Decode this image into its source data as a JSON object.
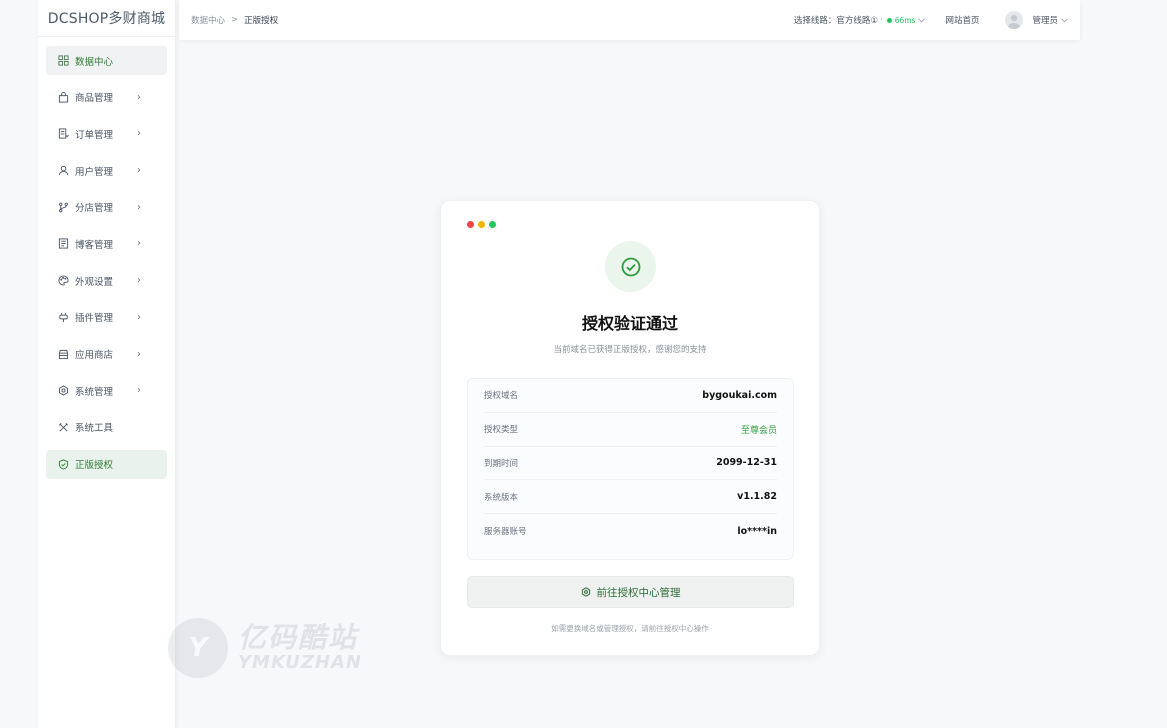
{
  "sidebar": {
    "logo": "DCSHOP多财商城",
    "items": [
      {
        "label": "数据中心",
        "icon": "dashboard-icon",
        "arrow": false
      },
      {
        "label": "商品管理",
        "icon": "shopping-bag-icon",
        "arrow": true
      },
      {
        "label": "订单管理",
        "icon": "order-list-icon",
        "arrow": true
      },
      {
        "label": "用户管理",
        "icon": "user-icon",
        "arrow": true
      },
      {
        "label": "分店管理",
        "icon": "branch-icon",
        "arrow": true
      },
      {
        "label": "博客管理",
        "icon": "document-icon",
        "arrow": true
      },
      {
        "label": "外观设置",
        "icon": "palette-icon",
        "arrow": true
      },
      {
        "label": "插件管理",
        "icon": "plugin-icon",
        "arrow": true
      },
      {
        "label": "应用商店",
        "icon": "store-icon",
        "arrow": true
      },
      {
        "label": "系统管理",
        "icon": "gear-icon",
        "arrow": true
      },
      {
        "label": "系统工具",
        "icon": "tools-icon",
        "arrow": false
      },
      {
        "label": "正版授权",
        "icon": "shield-check-icon",
        "arrow": false
      }
    ],
    "arrow_glyph": "›"
  },
  "header": {
    "breadcrumb": [
      "数据中心",
      "正版授权"
    ],
    "breadcrumb_sep": ">",
    "line_label": "选择线路：官方线路①",
    "line_sep": "·",
    "ping": "66ms",
    "home_link": "网站首页",
    "admin_name": "管理员"
  },
  "card": {
    "title": "授权验证通过",
    "subtitle": "当前域名已获得正版授权，感谢您的支持",
    "rows": [
      {
        "key": "授权域名",
        "value": "bygoukai.com"
      },
      {
        "key": "授权类型",
        "value": "至尊会员"
      },
      {
        "key": "到期时间",
        "value": "2099-12-31"
      },
      {
        "key": "系统版本",
        "value": "v1.1.82"
      },
      {
        "key": "服务器账号",
        "value": "lo****in"
      }
    ],
    "action_label": "前往授权中心管理",
    "footnote": "如需更换域名或管理授权，请前往授权中心操作"
  },
  "watermark": {
    "cn": "亿码酷站",
    "en": "YMKUZHAN"
  },
  "colors": {
    "accent_green": "#2e9c3c",
    "dot_red": "#ef4444",
    "dot_yellow": "#f5b400",
    "dot_green": "#22c55e"
  }
}
